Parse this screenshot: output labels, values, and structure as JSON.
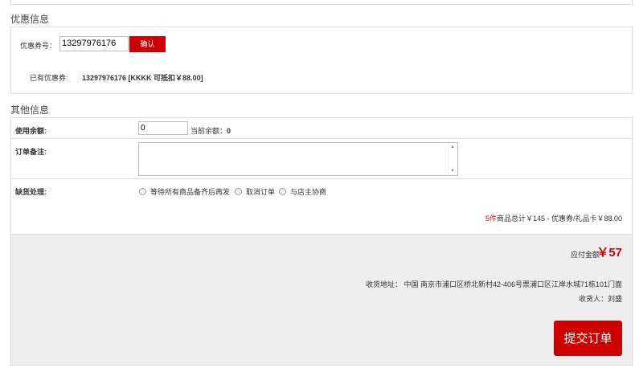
{
  "coupon": {
    "title": "优惠信息",
    "code_label": "优惠券号：",
    "code_value": "13297976176",
    "confirm_label": "确认",
    "had_label": "已有优惠券:",
    "had_value": "13297976176 [KKKK 可抵扣￥88.00]"
  },
  "other": {
    "title": "其他信息",
    "balance_label": "使用余额:",
    "balance_value": "0",
    "balance_current_label": "当前余额：",
    "balance_current_value": "0",
    "remark_label": "订单备注:",
    "stockout_label": "缺货处理:",
    "options": [
      "等待所有商品备齐后再发",
      "取消订单",
      "与店主协商"
    ],
    "summary_count": "5件",
    "summary_text": "商品总计￥145 - 优惠券/礼品卡￥88.00"
  },
  "payment": {
    "amount_label": "应付金额",
    "amount_value": "￥57",
    "address": "收货地址： 中国 南京市浦口区桥北新村42-406号票浦口区江岸水城71栋101门面",
    "receiver": "收货人：刘盛",
    "submit_label": "提交订单"
  },
  "colors": {
    "accent": "#cc0000",
    "pay_bg": "#eeeeee",
    "border": "#dddddd"
  }
}
